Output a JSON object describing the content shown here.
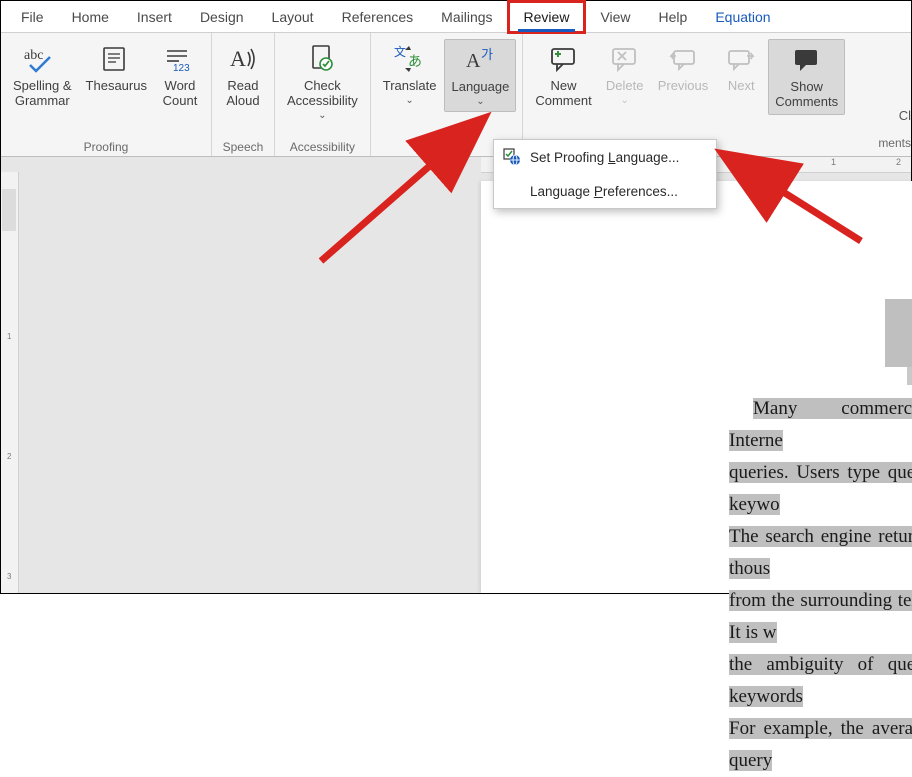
{
  "tabs": {
    "file": "File",
    "home": "Home",
    "insert": "Insert",
    "design": "Design",
    "layout": "Layout",
    "references": "References",
    "mailings": "Mailings",
    "review": "Review",
    "view": "View",
    "help": "Help",
    "equation": "Equation"
  },
  "ribbon": {
    "proofing": {
      "label": "Proofing",
      "spelling": "Spelling &\nGrammar",
      "thesaurus": "Thesaurus",
      "wordcount": "Word\nCount"
    },
    "speech": {
      "label": "Speech",
      "readaloud": "Read\nAloud"
    },
    "accessibility": {
      "label": "Accessibility",
      "check": "Check\nAccessibility"
    },
    "language": {
      "translate": "Translate",
      "language": "Language"
    },
    "comments": {
      "new": "New\nComment",
      "delete": "Delete",
      "previous": "Previous",
      "next": "Next",
      "show": "Show\nComments",
      "remainder": "ments",
      "cl": "Cl"
    }
  },
  "dropdown": {
    "set_pre": "Set Proofing ",
    "set_l": "L",
    "set_post": "anguage...",
    "pref_pre": "Language ",
    "pref_p": "P",
    "pref_post": "references..."
  },
  "ruler": {
    "h": [
      "1",
      "2"
    ],
    "v": [
      "1",
      "2",
      "3"
    ]
  },
  "doc": {
    "l1": "Many commercial Interne",
    "l2": "queries. Users type query keywo",
    "l3": "The search engine returns thous",
    "l4": "from the surrounding text. It is w",
    "l5": "the ambiguity of query keywords",
    "l6": "For example, the average query "
  }
}
